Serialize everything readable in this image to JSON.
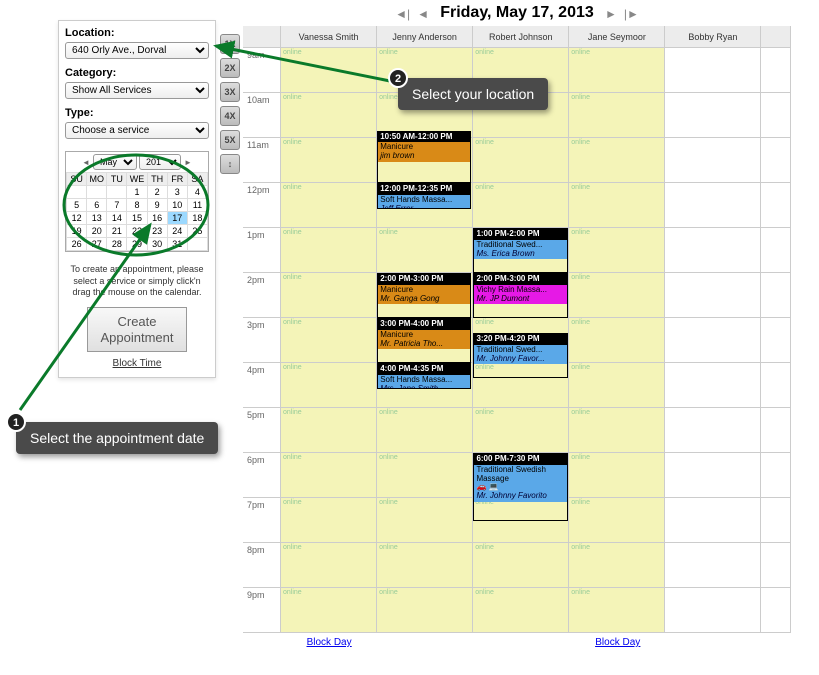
{
  "sidebar": {
    "location_label": "Location:",
    "location_value": "640 Orly Ave., Dorval",
    "category_label": "Category:",
    "category_value": "Show All Services",
    "type_label": "Type:",
    "type_value": "Choose a service",
    "help_text": "To create an appointment, please select a service or simply click'n drag the mouse on the calendar.",
    "create_button": "Create\nAppointment",
    "block_time": "Block Time"
  },
  "mini_cal": {
    "month": "May",
    "year": "201",
    "dow": [
      "SU",
      "MO",
      "TU",
      "WE",
      "TH",
      "FR",
      "SA"
    ],
    "weeks": [
      [
        "",
        "",
        "",
        "1",
        "2",
        "3",
        "4"
      ],
      [
        "5",
        "6",
        "7",
        "8",
        "9",
        "10",
        "11"
      ],
      [
        "12",
        "13",
        "14",
        "15",
        "16",
        "17",
        "18"
      ],
      [
        "19",
        "20",
        "21",
        "22",
        "23",
        "24",
        "25"
      ],
      [
        "26",
        "27",
        "28",
        "29",
        "30",
        "31",
        ""
      ]
    ],
    "selected": "17"
  },
  "zoom": [
    "1X",
    "2X",
    "3X",
    "4X",
    "5X",
    "↕"
  ],
  "date_title": "Friday, May 17, 2013",
  "staff": [
    "Vanessa Smith",
    "Jenny Anderson",
    "Robert Johnson",
    "Jane Seymoor",
    "Bobby Ryan"
  ],
  "hours": [
    "9am",
    "10am",
    "11am",
    "12pm",
    "1pm",
    "2pm",
    "3pm",
    "4pm",
    "5pm",
    "6pm",
    "7pm",
    "8pm",
    "9pm"
  ],
  "online_label": "online",
  "block_day": "Block Day",
  "avail_cols": [
    1,
    2,
    3,
    4
  ],
  "appointments": [
    {
      "col": 2,
      "start_min": 110,
      "dur_min": 70,
      "color": "orange",
      "time": "10:50 AM-12:00 PM",
      "svc": "Manicure",
      "client": "jim brown"
    },
    {
      "col": 2,
      "start_min": 180,
      "dur_min": 35,
      "color": "blue",
      "time": "12:00 PM-12:35 PM",
      "svc": "Soft Hands Massa...",
      "client": "Jeff Error"
    },
    {
      "col": 3,
      "start_min": 240,
      "dur_min": 60,
      "color": "blue",
      "time": "1:00 PM-2:00 PM",
      "svc": "Traditional Swed...",
      "client": "Ms. Erica Brown"
    },
    {
      "col": 2,
      "start_min": 300,
      "dur_min": 60,
      "color": "orange",
      "time": "2:00 PM-3:00 PM",
      "svc": "Manicure",
      "client": "Mr. Ganga Gong"
    },
    {
      "col": 3,
      "start_min": 300,
      "dur_min": 60,
      "color": "magenta",
      "time": "2:00 PM-3:00 PM",
      "svc": "Vichy Rain Massa...",
      "client": "Mr. JP Dumont"
    },
    {
      "col": 2,
      "start_min": 360,
      "dur_min": 60,
      "color": "orange",
      "time": "3:00 PM-4:00 PM",
      "svc": "Manicure",
      "client": "Mr. Patricia Tho..."
    },
    {
      "col": 3,
      "start_min": 380,
      "dur_min": 60,
      "color": "blue",
      "time": "3:20 PM-4:20 PM",
      "svc": "Traditional Swed...",
      "client": "Mr. Johnny Favor..."
    },
    {
      "col": 2,
      "start_min": 420,
      "dur_min": 35,
      "color": "blue",
      "time": "4:00 PM-4:35 PM",
      "svc": "Soft Hands Massa...",
      "client": "Mrs. Jane Smith"
    },
    {
      "col": 3,
      "start_min": 540,
      "dur_min": 90,
      "color": "blue",
      "time": "6:00 PM-7:30 PM",
      "svc": "Traditional Swedish Massage",
      "client": "Mr. Johnny Favorito",
      "icons": true
    }
  ],
  "callouts": {
    "c1": {
      "num": "1",
      "text": "Select the appointment date"
    },
    "c2": {
      "num": "2",
      "text": "Select your location"
    }
  }
}
